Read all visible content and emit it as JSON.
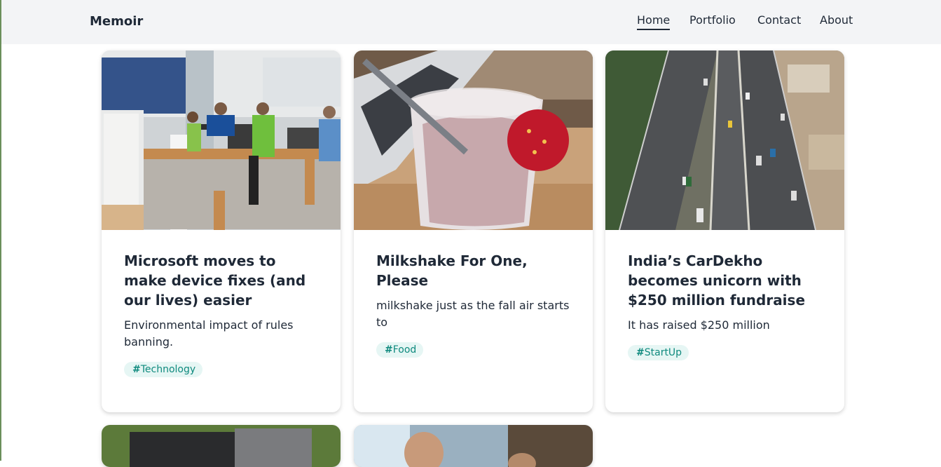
{
  "brand": "Memoir",
  "nav": [
    {
      "label": "Home",
      "active": true
    },
    {
      "label": "Portfolio",
      "active": false
    },
    {
      "label": "Contact",
      "active": false
    },
    {
      "label": "About",
      "active": false
    }
  ],
  "cards": [
    {
      "title": "Microsoft moves to make device fixes (and our lives) easier",
      "description": "Environmental impact of rules banning.",
      "tag_hash": "#",
      "tag": "Technology",
      "image": "microsoft-store-photo"
    },
    {
      "title": "Milkshake For One, Please",
      "description": "milkshake just as the fall air starts to",
      "tag_hash": "#",
      "tag": "Food",
      "image": "milkshake-photo"
    },
    {
      "title": "India’s CarDekho becomes unicorn with $250 million fundraise",
      "description": "It has raised $250 million",
      "tag_hash": "#",
      "tag": "StartUp",
      "image": "highway-aerial-photo"
    },
    {
      "image": "laptop-photo"
    },
    {
      "image": "people-photo"
    }
  ],
  "colors": {
    "nav_bg": "#f3f4f6",
    "tag_bg": "#e6f6f4",
    "tag_text": "#0f8a7e"
  }
}
